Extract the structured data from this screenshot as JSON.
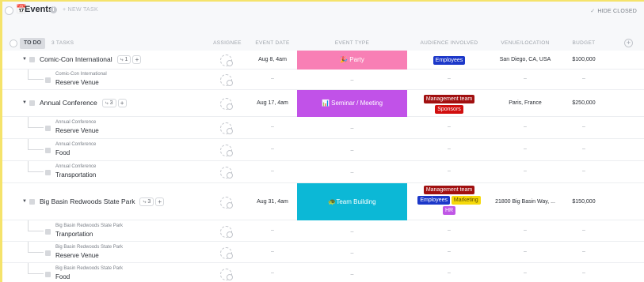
{
  "header": {
    "title": "Events",
    "new_task": "+ NEW TASK",
    "hide_closed": "HIDE CLOSED"
  },
  "group": {
    "status": "TO DO",
    "count": "3 TASKS",
    "columns": {
      "assignee": "ASSIGNEE",
      "event_date": "EVENT DATE",
      "event_type": "EVENT TYPE",
      "audience": "AUDIENCE INVOLVED",
      "venue": "VENUE/LOCATION",
      "budget": "BUDGET"
    }
  },
  "tasks": [
    {
      "name": "Comic-Con International",
      "subcount": "1",
      "add": "+",
      "date": "Aug 8, 4am",
      "event_type": "🎉 Party",
      "event_type_color": "#f87fb5",
      "audience": [
        {
          "label": "Employees",
          "color": "#1c38c9"
        }
      ],
      "venue": "San Diego, CA, USA",
      "budget": "$100,000"
    },
    {
      "name": "Annual Conference",
      "subcount": "3",
      "add": "+",
      "date": "Aug 17, 4am",
      "event_type": "📊 Seminar / Meeting",
      "event_type_color": "#c152e8",
      "audience": [
        {
          "label": "Management team",
          "color": "#a11010"
        },
        {
          "label": "Sponsors",
          "color": "#d10f0f"
        }
      ],
      "venue": "Paris, France",
      "budget": "$250,000"
    },
    {
      "name": "Big Basin Redwoods State Park",
      "subcount": "3",
      "add": "+",
      "date": "Aug 31, 4am",
      "event_type": "🐢Team Building",
      "event_type_color": "#0cb8d6",
      "audience": [
        {
          "label": "Management team",
          "color": "#a11010"
        },
        {
          "label": "Employees",
          "color": "#1c38c9"
        },
        {
          "label": "Marketing",
          "color": "#f5d90c",
          "text": "#5a4a00"
        },
        {
          "label": "HR",
          "color": "#c057e6"
        }
      ],
      "venue": "21800 Big Basin Way, ...",
      "budget": "$150,000"
    }
  ],
  "subtasks": [
    {
      "parent": "Comic-Con International",
      "name": "Reserve Venue"
    },
    {
      "parent": "Annual Conference",
      "name": "Reserve Venue"
    },
    {
      "parent": "Annual Conference",
      "name": "Food"
    },
    {
      "parent": "Annual Conference",
      "name": "Transportation"
    },
    {
      "parent": "Big Basin Redwoods State Park",
      "name": "Tranportation"
    },
    {
      "parent": "Big Basin Redwoods State Park",
      "name": "Reserve Venue"
    },
    {
      "parent": "Big Basin Redwoods State Park",
      "name": "Food"
    }
  ],
  "empty_value": "–"
}
